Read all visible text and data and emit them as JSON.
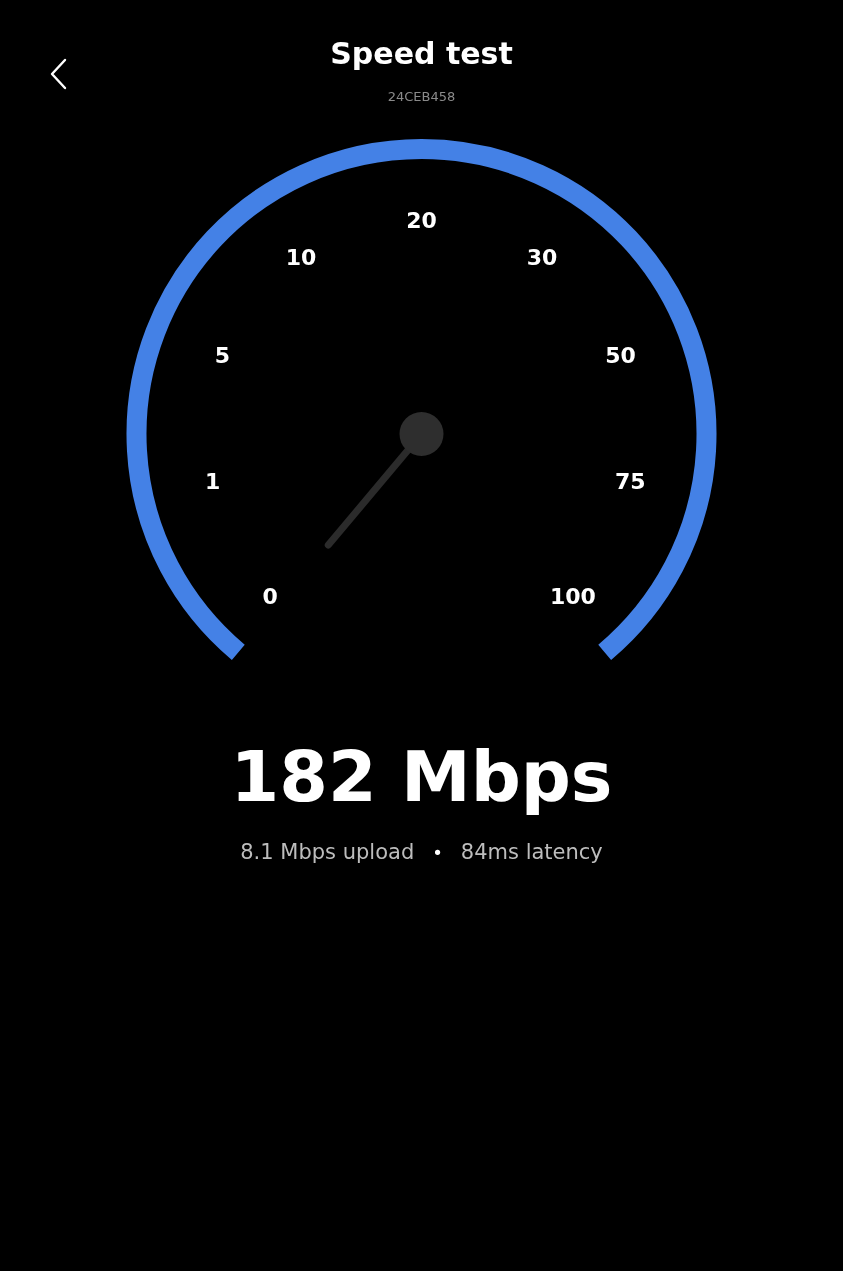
{
  "header": {
    "title": "Speed test",
    "subtitle": "24CEB458"
  },
  "gauge": {
    "scale_labels": [
      "0",
      "1",
      "5",
      "10",
      "20",
      "30",
      "50",
      "75",
      "100"
    ]
  },
  "result": {
    "speed": "182 Mbps",
    "upload": "8.1 Mbps upload",
    "separator": "•",
    "latency": "84ms latency"
  }
}
